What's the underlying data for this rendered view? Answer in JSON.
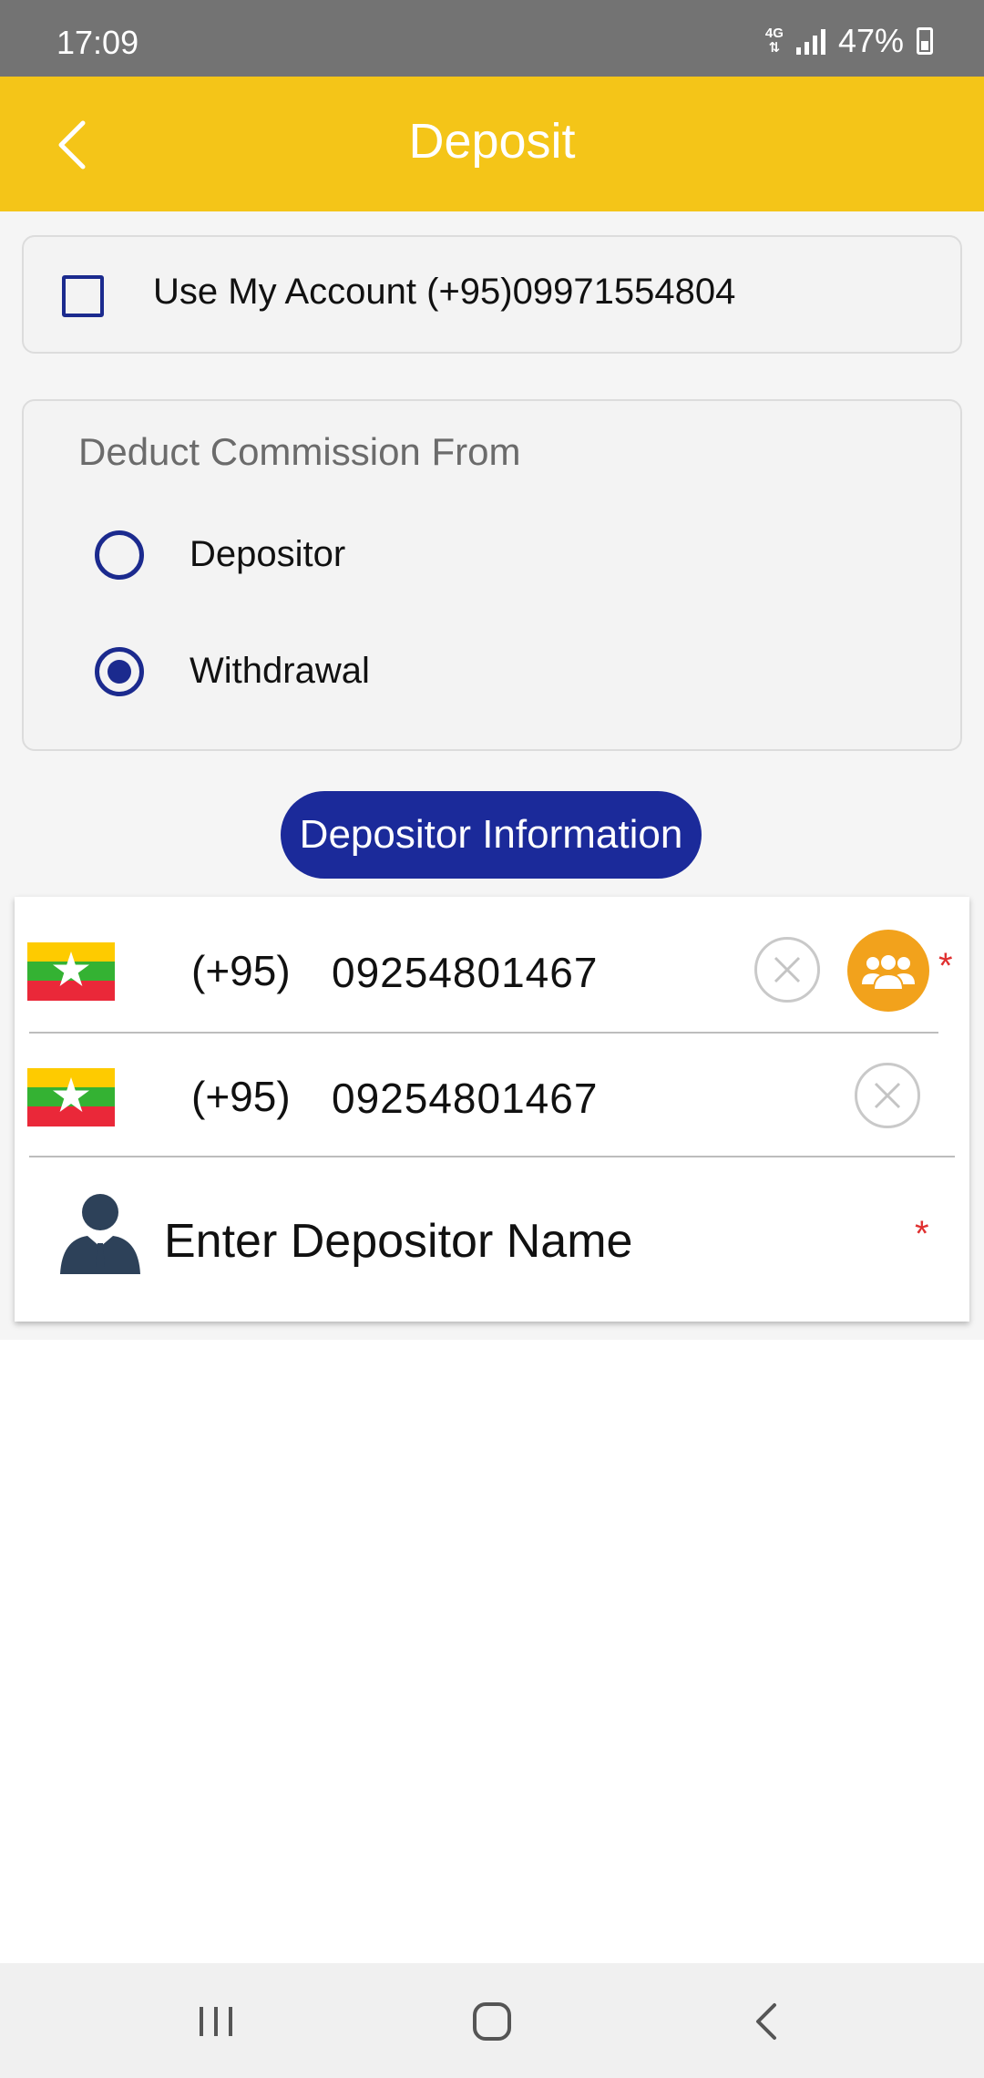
{
  "status_bar": {
    "time": "17:09",
    "network_type": "4G",
    "battery": "47%"
  },
  "app_bar": {
    "title": "Deposit",
    "back_icon": "chevron-left-icon"
  },
  "use_account": {
    "label": "Use My Account (+95)09971554804",
    "checked": false
  },
  "commission": {
    "title": "Deduct Commission From",
    "options": [
      {
        "label": "Depositor",
        "selected": false
      },
      {
        "label": "Withdrawal",
        "selected": true
      }
    ]
  },
  "depositor_section": {
    "title": "Depositor Information",
    "phone_rows": [
      {
        "flag": "myanmar-flag",
        "country_code": "(+95)",
        "number": "09254801467",
        "has_contacts_button": true,
        "required": true
      },
      {
        "flag": "myanmar-flag",
        "country_code": "(+95)",
        "number": "09254801467",
        "has_contacts_button": false,
        "required": false
      }
    ],
    "name_field": {
      "placeholder": "Enter Depositor Name",
      "value": "",
      "required": true,
      "icon": "person-icon"
    },
    "required_marker": "*"
  },
  "colors": {
    "app_bar": "#f4c518",
    "primary_blue": "#1b2a9a",
    "contacts_orange": "#f2a21c",
    "required_red": "#e03030"
  }
}
